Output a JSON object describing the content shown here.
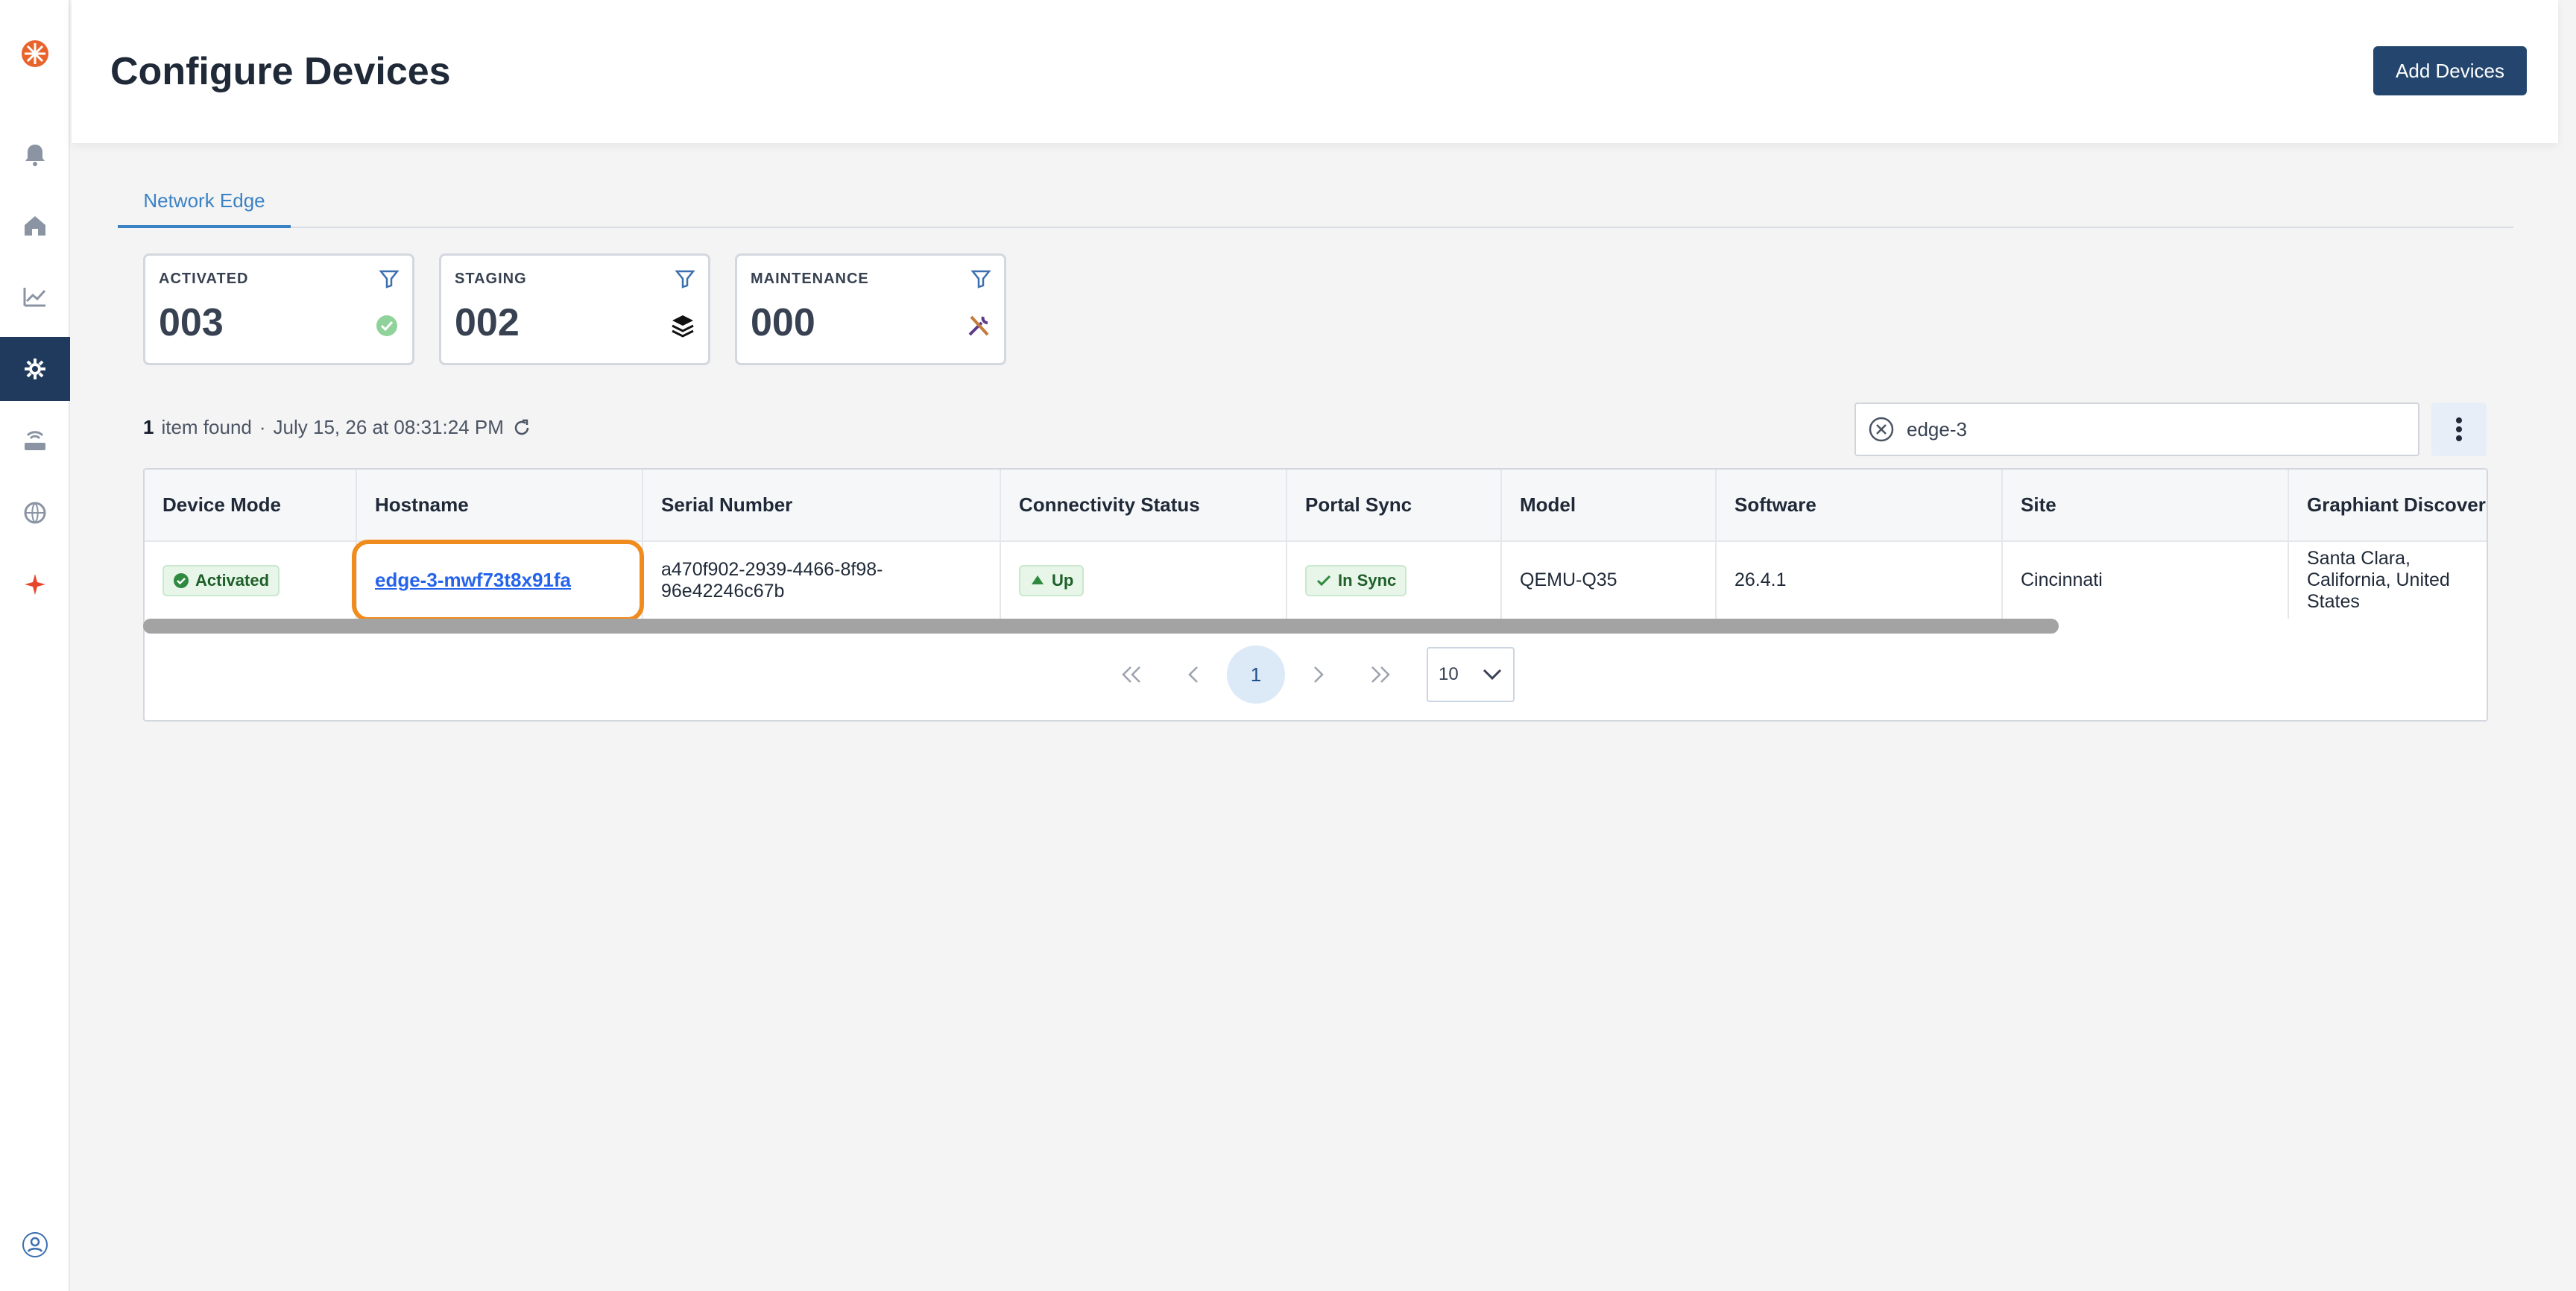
{
  "header": {
    "title": "Configure Devices",
    "add_button": "Add Devices"
  },
  "tabs": [
    {
      "label": "Network Edge",
      "active": true
    }
  ],
  "stats": [
    {
      "label": "ACTIVATED",
      "value": "003",
      "status_icon": "check-circle-icon"
    },
    {
      "label": "STAGING",
      "value": "002",
      "status_icon": "layers-icon"
    },
    {
      "label": "MAINTENANCE",
      "value": "000",
      "status_icon": "tools-icon"
    }
  ],
  "summary": {
    "count": "1",
    "text": "item found",
    "separator": "·",
    "timestamp": "July 15, 26 at 08:31:24 PM"
  },
  "search": {
    "value": "edge-3"
  },
  "table": {
    "columns": [
      "Device Mode",
      "Hostname",
      "Serial Number",
      "Connectivity Status",
      "Portal Sync",
      "Model",
      "Software",
      "Site",
      "Graphiant Discovered"
    ],
    "rows": [
      {
        "device_mode": "Activated",
        "hostname": "edge-3-mwf73t8x91fa",
        "serial_number": "a470f902-2939-4466-8f98-96e42246c67b",
        "connectivity": "Up",
        "portal_sync": "In Sync",
        "model": "QEMU-Q35",
        "software": "26.4.1",
        "site": "Cincinnati",
        "discovered": "Santa Clara, California, United States"
      }
    ]
  },
  "pagination": {
    "current_page": "1",
    "page_size": "10"
  },
  "colors": {
    "primary": "#24466e",
    "accent": "#3b82c4",
    "highlight": "#f08c1e",
    "success": "#1f5f2a"
  }
}
